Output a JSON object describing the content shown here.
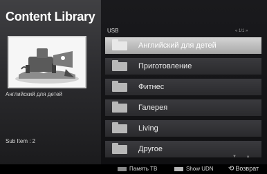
{
  "app": {
    "title": "Content Library"
  },
  "preview": {
    "caption": "Английский для детей",
    "sub_item": "Sub Item : 2"
  },
  "browser": {
    "source": "USB",
    "page_indicator": "« 1/1 »",
    "items": [
      {
        "label": "Английский для детей",
        "icon": "folder-icon",
        "selected": true
      },
      {
        "label": "Приготовление",
        "icon": "folder-icon",
        "selected": false
      },
      {
        "label": "Фитнес",
        "icon": "folder-icon",
        "selected": false
      },
      {
        "label": "Галерея",
        "icon": "folder-icon",
        "selected": false
      },
      {
        "label": "Living",
        "icon": "folder-icon",
        "selected": false
      },
      {
        "label": "Другое",
        "icon": "folder-icon",
        "selected": false
      }
    ],
    "scroll_arrows": "▼ ▲"
  },
  "footer": {
    "memory_label": "Память ТВ",
    "show_udn_label": "Show UDN",
    "return_label": "Возврат"
  },
  "colors": {
    "memory_key": "#8a8a8a",
    "show_udn_key": "#b5b5b5",
    "selected_row": "#bdbdbd"
  }
}
